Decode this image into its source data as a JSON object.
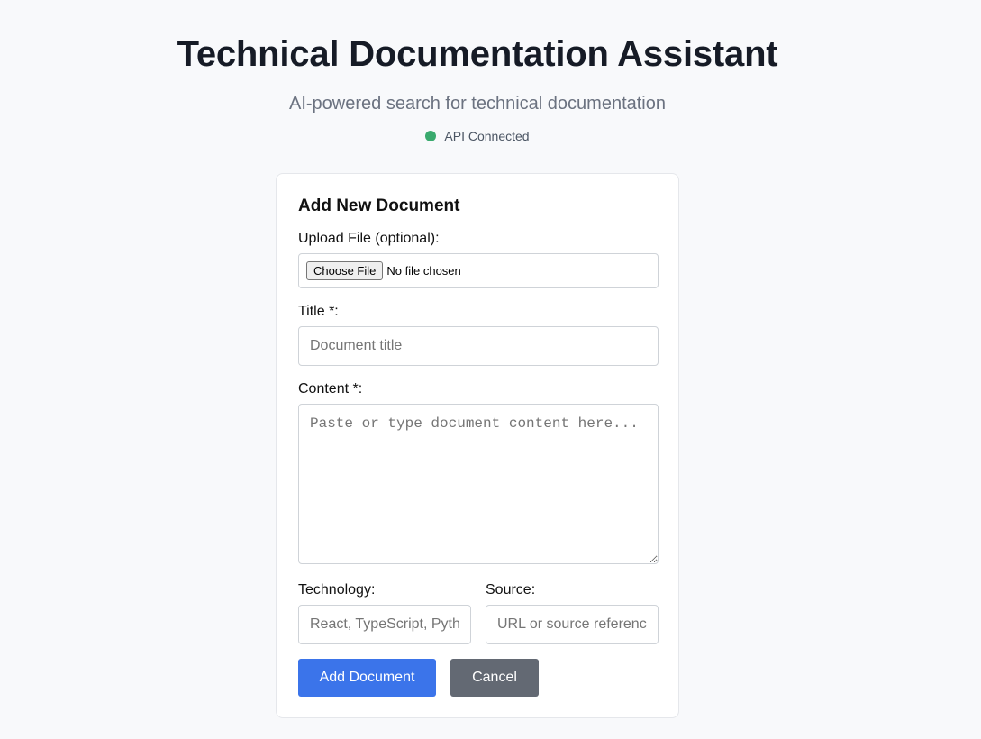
{
  "header": {
    "title": "Technical Documentation Assistant",
    "subtitle": "AI-powered search for technical documentation",
    "status_text": "API Connected",
    "status_color": "#3aaa6e"
  },
  "form": {
    "heading": "Add New Document",
    "upload_label": "Upload File (optional):",
    "choose_file_label": "Choose File",
    "file_status": "No file chosen",
    "title_label": "Title *:",
    "title_placeholder": "Document title",
    "title_value": "",
    "content_label": "Content *:",
    "content_placeholder": "Paste or type document content here...",
    "content_value": "",
    "technology_label": "Technology:",
    "technology_placeholder": "React, TypeScript, Python, etc.",
    "technology_value": "",
    "source_label": "Source:",
    "source_placeholder": "URL or source reference",
    "source_value": "",
    "submit_label": "Add Document",
    "cancel_label": "Cancel"
  },
  "colors": {
    "primary": "#3b74ea",
    "secondary": "#636973",
    "background": "#f8f9fb"
  }
}
